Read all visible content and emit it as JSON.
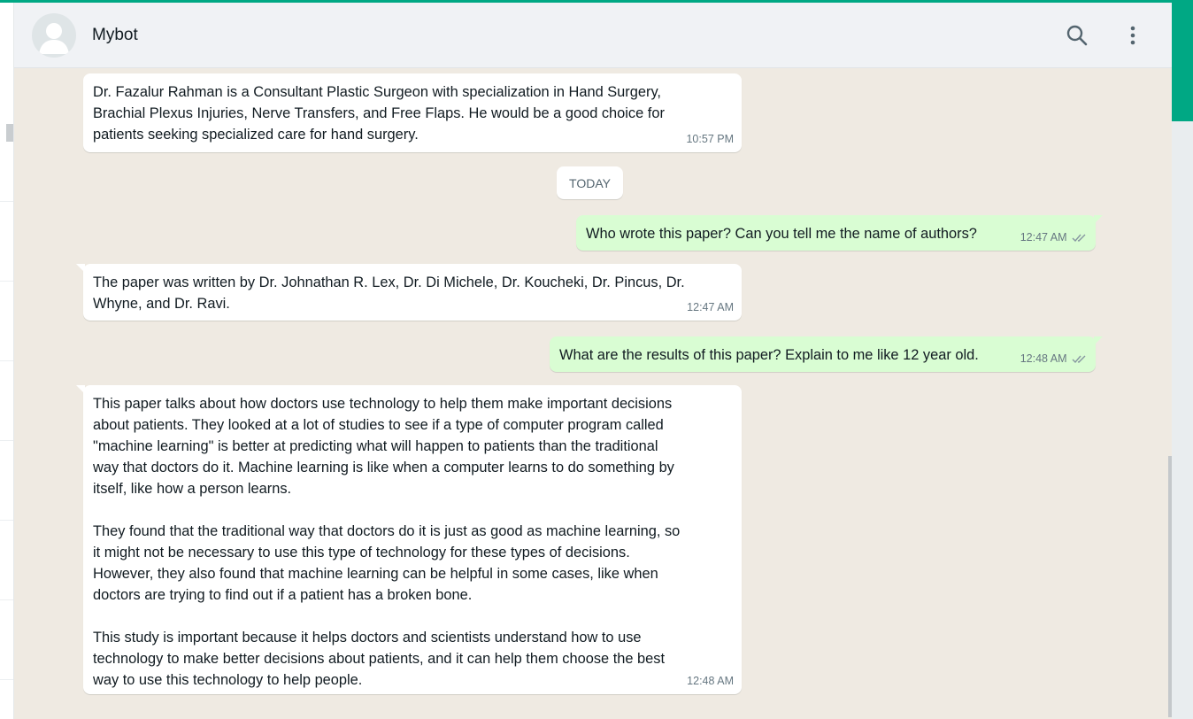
{
  "header": {
    "contact_name": "Mybot",
    "search_icon": "search-icon",
    "menu_icon": "kebab-menu-icon",
    "avatar_icon": "default-avatar-icon"
  },
  "colors": {
    "accent": "#00a884",
    "incoming_bubble": "#ffffff",
    "outgoing_bubble": "#d9fdd3",
    "chat_background": "#efeae2",
    "header_background": "#f0f2f5",
    "read_ticks": "#8696a0"
  },
  "date_divider": "TODAY",
  "messages": [
    {
      "direction": "in",
      "text": "Dr. Fazalur Rahman is a Consultant Plastic Surgeon with specialization in Hand Surgery,\nBrachial Plexus Injuries, Nerve Transfers, and Free Flaps. He would be a good choice for\npatients seeking specialized care for hand surgery.",
      "time": "10:57 PM"
    },
    {
      "direction": "out",
      "text": "Who wrote this paper? Can you tell me the name of authors?",
      "time": "12:47 AM",
      "status_icon": "double-check-icon"
    },
    {
      "direction": "in",
      "text": "The paper was written by Dr. Johnathan R. Lex, Dr. Di Michele, Dr. Koucheki, Dr. Pincus, Dr.\nWhyne, and Dr. Ravi.",
      "time": "12:47 AM"
    },
    {
      "direction": "out",
      "text": "What are the results of this paper? Explain to me like 12 year old.",
      "time": "12:48 AM",
      "status_icon": "double-check-icon"
    },
    {
      "direction": "in",
      "text": "This paper talks about how doctors use technology to help them make important decisions\nabout patients. They looked at a lot of studies to see if a type of computer program called\n\"machine learning\" is better at predicting what will happen to patients than the traditional\nway that doctors do it. Machine learning is like when a computer learns to do something by\nitself, like how a person learns.\n\nThey found that the traditional way that doctors do it is just as good as machine learning, so\nit might not be necessary to use this type of technology for these types of decisions.\nHowever, they also found that machine learning can be helpful in some cases, like when\ndoctors are trying to find out if a patient has a broken bone.\n\nThis study is important because it helps doctors and scientists understand how to use\ntechnology to make better decisions about patients, and it can help them choose the best\nway to use this technology to help people.",
      "time": "12:48 AM"
    }
  ]
}
